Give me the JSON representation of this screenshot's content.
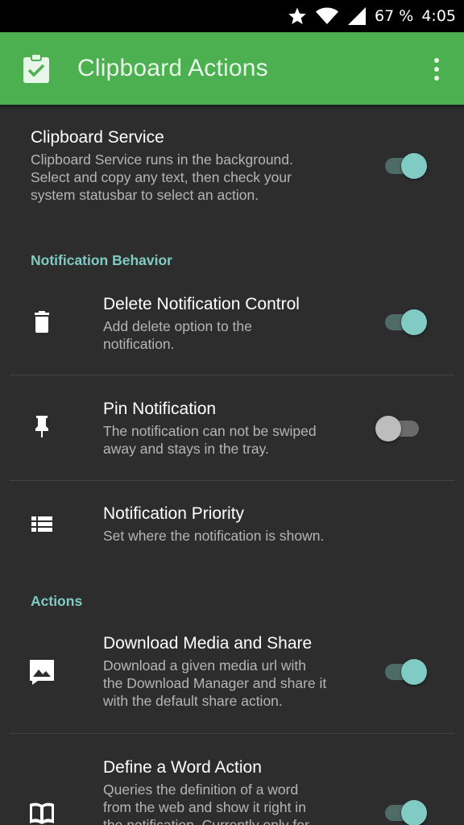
{
  "statusbar": {
    "battery": "67 %",
    "time": "4:05"
  },
  "appbar": {
    "title": "Clipboard Actions"
  },
  "service": {
    "title": "Clipboard Service",
    "summary_lines": [
      "Clipboard Service runs in the background.",
      "Select and copy any text, then check your",
      "system statusbar to select an action."
    ],
    "enabled": true
  },
  "categories": {
    "notification": "Notification Behavior",
    "actions": "Actions"
  },
  "notification_prefs": [
    {
      "title": "Delete Notification Control",
      "summary_lines": [
        "Add delete option to the",
        "notification."
      ],
      "icon": "trash-icon",
      "enabled": true
    },
    {
      "title": "Pin Notification",
      "summary_lines": [
        "The notification can not be swiped",
        "away and stays in the tray."
      ],
      "icon": "pin-icon",
      "enabled": false
    },
    {
      "title": "Notification Priority",
      "summary_lines": [
        "Set where the notification is shown."
      ],
      "icon": "list-icon"
    }
  ],
  "action_prefs": [
    {
      "title": "Download Media and Share",
      "summary_lines": [
        "Download a given media url with",
        "the Download Manager and share it",
        "with the default share action."
      ],
      "icon": "image-icon",
      "enabled": true
    },
    {
      "title": "Define a Word Action",
      "summary_lines": [
        "Queries the definition of a word",
        "from the web and show it right in",
        "the notification. Currently only for"
      ],
      "icon": "book-icon",
      "enabled": true
    }
  ],
  "colors": {
    "appbar": "#4caf50",
    "accent": "#80cbc4",
    "background": "#2d2d2d"
  }
}
